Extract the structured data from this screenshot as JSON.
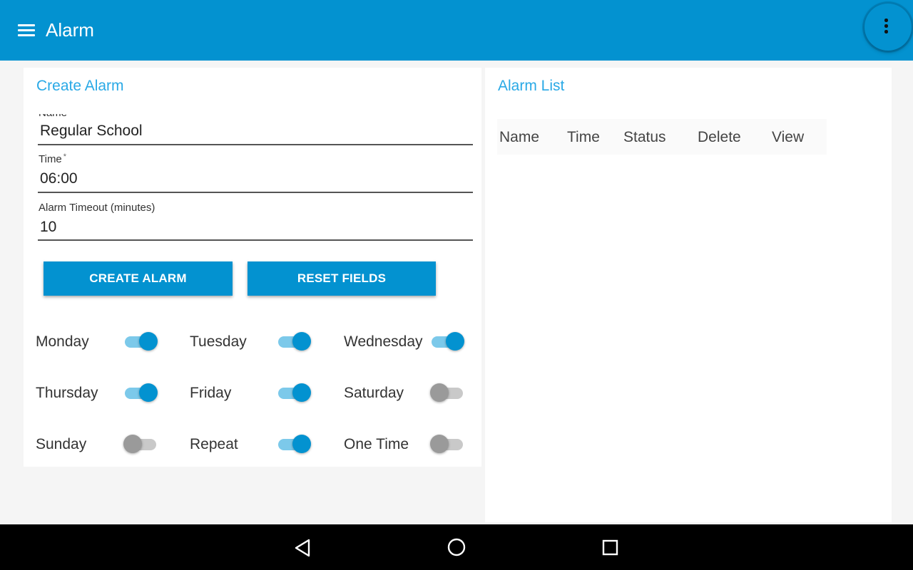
{
  "app_bar": {
    "title": "Alarm",
    "menu_icon": "menu-icon",
    "more_icon": "more-vert-icon",
    "color": "#0392d0"
  },
  "create_panel": {
    "title": "Create Alarm",
    "fields": {
      "name": {
        "label": "Name",
        "value": "Regular School"
      },
      "time": {
        "label": "Time",
        "required_mark": "*",
        "value": "06:00"
      },
      "timeout": {
        "label": "Alarm Timeout (minutes)",
        "value": "10"
      }
    },
    "buttons": {
      "create": "CREATE ALARM",
      "reset": "RESET FIELDS"
    },
    "toggles": [
      {
        "label": "Monday",
        "on": true
      },
      {
        "label": "Tuesday",
        "on": true
      },
      {
        "label": "Wednesday",
        "on": true
      },
      {
        "label": "Thursday",
        "on": true
      },
      {
        "label": "Friday",
        "on": true
      },
      {
        "label": "Saturday",
        "on": false
      },
      {
        "label": "Sunday",
        "on": false
      },
      {
        "label": "Repeat",
        "on": true
      },
      {
        "label": "One Time",
        "on": false
      }
    ]
  },
  "list_panel": {
    "title": "Alarm List",
    "columns": [
      "Name",
      "Time",
      "Status",
      "Delete",
      "View"
    ]
  },
  "nav_bar": {
    "icons": [
      "back-icon",
      "home-icon",
      "recents-icon"
    ]
  }
}
